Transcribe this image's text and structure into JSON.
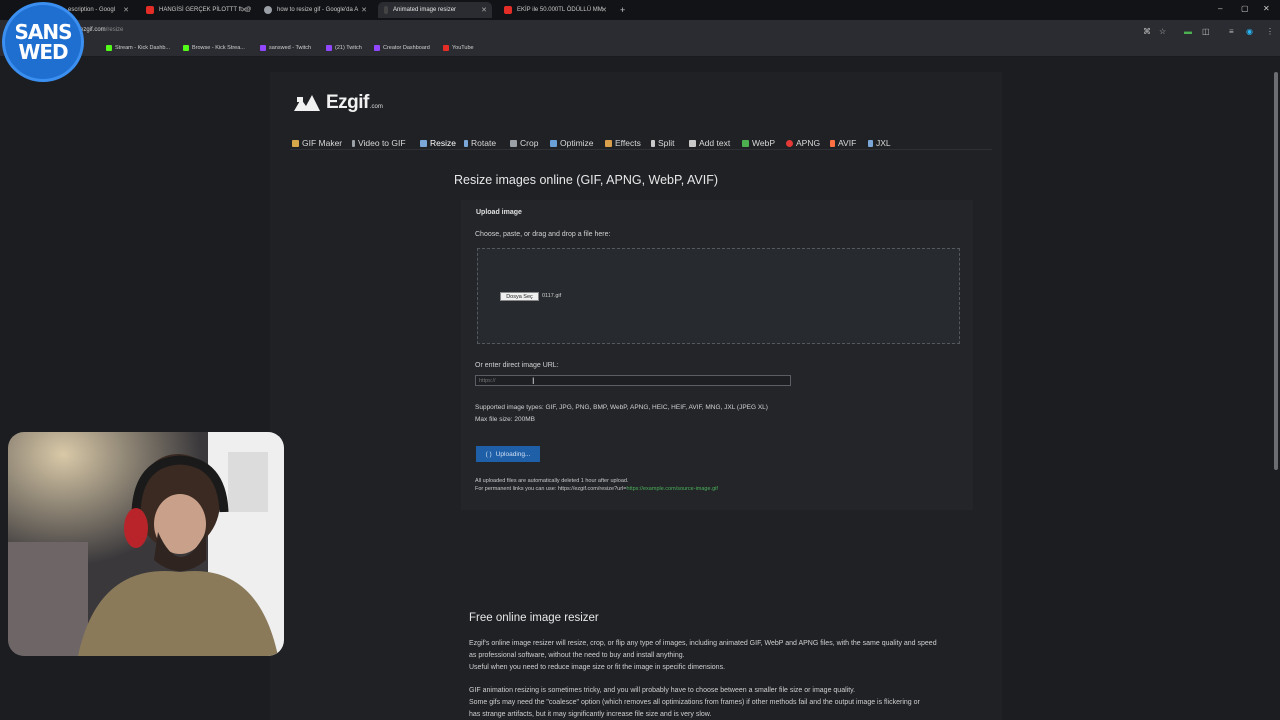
{
  "browser": {
    "tabs": [
      {
        "title": "escription - Googl",
        "color": "#3b78e7"
      },
      {
        "title": "HANGİSİ GERÇEK PİLOTTT ft. @",
        "color": "#e52d27"
      },
      {
        "title": "how to resize gif - Google'da A",
        "color": "#9aa0a6"
      },
      {
        "title": "Animated image resizer",
        "color": "#e8e8e8"
      },
      {
        "title": "EKİP ile 50.000TL ÖDÜLLÜ MM",
        "color": "#e52d27"
      }
    ],
    "new_tab": "+",
    "url": "ezgif.com/resize",
    "url_prefix": "ezgif.com",
    "url_path": "/resize",
    "bookmarks": [
      {
        "label": "Stream - Kick Dashb...",
        "color": "#53fc18"
      },
      {
        "label": "Browse - Kick Strea...",
        "color": "#53fc18"
      },
      {
        "label": "sanswed - Twitch",
        "color": "#9146ff"
      },
      {
        "label": "(21) Twitch",
        "color": "#9146ff"
      },
      {
        "label": "Creator Dashboard",
        "color": "#9146ff"
      },
      {
        "label": "YouTube",
        "color": "#e52d27"
      }
    ]
  },
  "site": {
    "logo_word": "Ezgif",
    "logo_domain": ".com",
    "nav": [
      {
        "label": "GIF Maker",
        "color": "#d6a84a"
      },
      {
        "label": "Video to GIF",
        "color": "#9aa0a6"
      },
      {
        "label": "Resize",
        "color": "#7aa7d8"
      },
      {
        "label": "Rotate",
        "color": "#7aa7d8"
      },
      {
        "label": "Crop",
        "color": "#9aa0a6"
      },
      {
        "label": "Optimize",
        "color": "#6aa0d8"
      },
      {
        "label": "Effects",
        "color": "#d8a04a"
      },
      {
        "label": "Split",
        "color": "#c9c9c9"
      },
      {
        "label": "Add text",
        "color": "#c9c9c9"
      },
      {
        "label": "WebP",
        "color": "#4caf50"
      },
      {
        "label": "APNG",
        "color": "#e53935"
      },
      {
        "label": "AVIF",
        "color": "#ff7043"
      },
      {
        "label": "JXL",
        "color": "#7aa7d8"
      }
    ],
    "page_title": "Resize images online (GIF, APNG, WebP, AVIF)",
    "upload": {
      "heading": "Upload image",
      "drop_label": "Choose, paste, or drag and drop a file here:",
      "file_button": "Dosya Seç",
      "file_name": "0117.gif",
      "url_label": "Or enter direct image URL:",
      "url_placeholder": "https://",
      "supported": "Supported image types: GIF, JPG, PNG, BMP, WebP, APNG, HEIC, HEIF, AVIF, MNG, JXL (JPEG XL)",
      "max_size": "Max file size: 200MB",
      "button": "Uploading...",
      "note1": "All uploaded files are automatically deleted 1 hour after upload.",
      "note2_prefix": "For permanent links you can use: https://ezgif.com/resize?url=",
      "note2_link": "https://example.com/source-image.gif"
    },
    "about": {
      "heading": "Free online image resizer",
      "p1_line1": "Ezgif's online image resizer will resize, crop, or flip any type of images, including animated GIF, WebP and APNG files, with the same quality and speed",
      "p1_line2": "as professional software, without the need to buy and install anything.",
      "p1_line3": "Useful when you need to reduce image size or fit the image in specific dimensions.",
      "p2_line1": "GIF animation resizing is sometimes tricky, and you will probably have to choose between a smaller file size or image quality.",
      "p2_line2": "Some gifs may need the \"coalesce\" option (which removes all optimizations from frames) if other methods fail and the output image is flickering or",
      "p2_line3": "has strange artifacts, but it may significantly increase file size and is very slow."
    }
  },
  "overlay": {
    "badge_line1": "SANS",
    "badge_line2": "WED"
  }
}
